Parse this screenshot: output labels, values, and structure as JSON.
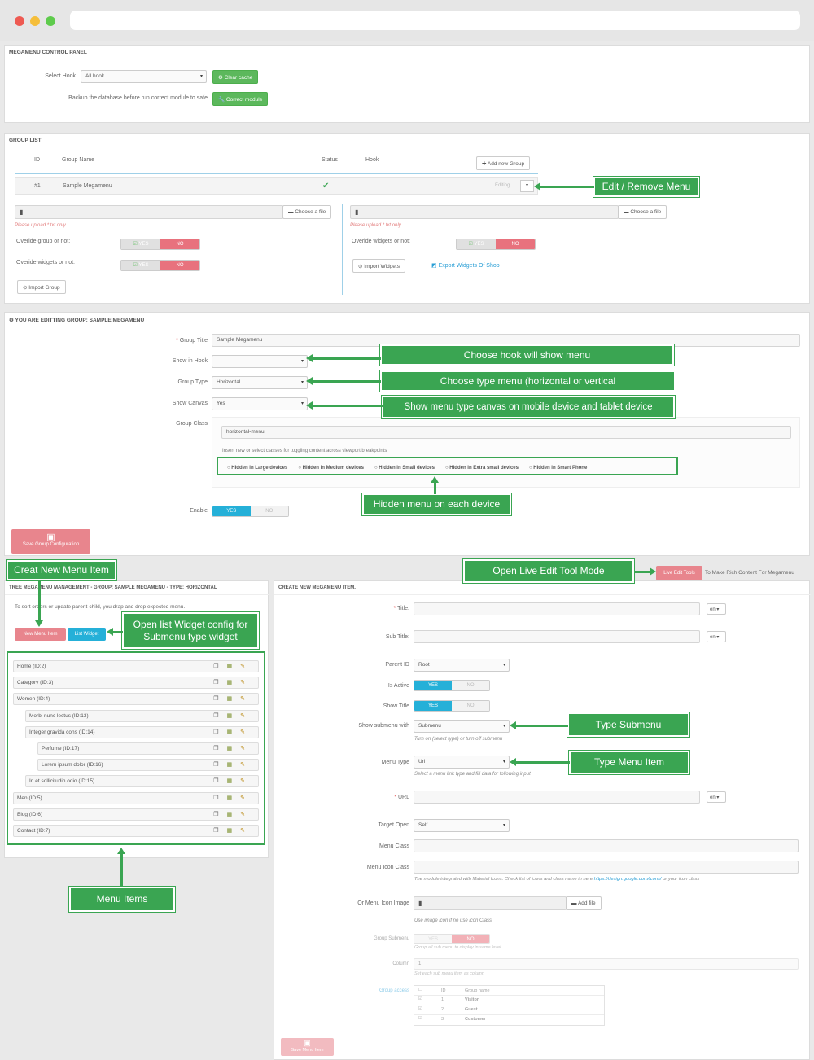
{
  "window": {
    "colors": {
      "close": "#ee5a52",
      "min": "#f5be3a",
      "max": "#5ecb4c"
    }
  },
  "control_panel": {
    "title": "MEGAMENU CONTROL PANEL",
    "select_hook_label": "Select Hook",
    "select_hook_value": "All hook",
    "clear_cache": "Clear cache",
    "backup_label": "Backup the database before run correct module to safe",
    "correct_module": "Correct module"
  },
  "group_list": {
    "title": "GROUP LIST",
    "columns": {
      "id": "ID",
      "name": "Group Name",
      "status": "Status",
      "hook": "Hook"
    },
    "add_new": "Add new Group",
    "row": {
      "id": "#1",
      "name": "Sample Megamenu",
      "status": "✔",
      "action": "Editing"
    },
    "choose_file": "Choose a file",
    "upload_hint": "Please upload *.txt only",
    "override_group": "Overide group or not:",
    "override_widgets": "Overide widgets or not:",
    "yes": "YES",
    "no": "NO",
    "import_group": "Import Group",
    "import_widgets": "Import Widgets",
    "export_widgets": "Export Widgets Of Shop"
  },
  "editing": {
    "title": "YOU ARE EDITTING GROUP: SAMPLE MEGAMENU",
    "group_title_label": "Group Title",
    "group_title_value": "Sample Megamenu",
    "show_in_hook": "Show in Hook",
    "group_type": "Group Type",
    "group_type_value": "Horizontal",
    "show_canvas": "Show Canvas",
    "show_canvas_value": "Yes",
    "group_class": "Group Class",
    "group_class_value": "horizontal-menu",
    "class_hint": "Insert new or select classes for toggling content across viewport breakpoints",
    "hidden": [
      "Hidden in Large devices",
      "Hidden in Medium devices",
      "Hidden in Small devices",
      "Hidden in Extra small devices",
      "Hidden in Smart Phone"
    ],
    "enable": "Enable",
    "yes": "YES",
    "no": "NO",
    "save": "Save Group Configuration"
  },
  "tree": {
    "title": "TREE MEGAMENU MANAGEMENT - GROUP: SAMPLE MEGAMENU - TYPE: HORIZONTAL",
    "hint": "To sort orders or update parent-child, you drap and drop expected menu.",
    "new_item": "New Menu Item",
    "list_widget": "List Widget",
    "items": [
      "Home (ID:2)",
      "Category (ID:3)",
      "Women (ID:4)",
      "Morbi nunc lectus (ID:13)",
      "Integer gravida cons (ID:14)",
      "Perfume (ID:17)",
      "Lorem ipsum dolor (ID:16)",
      "In et sollicitudin odio (ID:15)",
      "Men (ID:5)",
      "Blog (ID:6)",
      "Contact (ID:7)"
    ]
  },
  "create": {
    "title": "CREATE NEW MEGAMENU ITEM.",
    "live_edit": "Live Edit Tools",
    "live_edit_note": "To Make Rich Content For Megamenu",
    "title_label": "Title:",
    "subtitle_label": "Sub Title:",
    "lang": "en",
    "parent_label": "Parent ID",
    "parent_value": "Root",
    "active_label": "Is Active",
    "show_title_label": "Show Title",
    "show_submenu_label": "Show submenu with",
    "show_submenu_value": "Submenu",
    "submenu_hint": "Turn on (select type) or turn off submenu",
    "menu_type_label": "Menu Type",
    "menu_type_value": "Url",
    "menu_type_hint": "Select a menu link type and fill data for following input",
    "url_label": "URL",
    "target_label": "Target Open",
    "target_value": "Self",
    "menu_class_label": "Menu Class",
    "menu_icon_label": "Menu Icon Class",
    "icon_hint": "The module integrated with Material Icons. Check list of icons and class name in here",
    "icon_link": "https://design.google.com/icons/",
    "icon_hint2": "or your icon class",
    "or_image_label": "Or Menu Icon Image",
    "add_file": "Add file",
    "image_hint": "Use image icon if no use icon Class",
    "group_submenu_label": "Group Submenu",
    "group_submenu_hint": "Group all sub menu to display in same level",
    "column_label": "Column",
    "column_value": "1",
    "column_hint": "Set each sub menu item as column",
    "group_access_label": "Group access",
    "access_cols": {
      "id": "ID",
      "name": "Group name"
    },
    "access_rows": [
      {
        "id": "1",
        "name": "Visitor"
      },
      {
        "id": "2",
        "name": "Guest"
      },
      {
        "id": "3",
        "name": "Customer"
      }
    ],
    "save": "Save Menu Item",
    "yes": "YES",
    "no": "NO"
  },
  "callouts": {
    "edit_remove": "Edit / Remove Menu",
    "choose_hook": "Choose hook will show menu",
    "choose_type": "Choose type menu (horizontal or vertical",
    "show_canvas": "Show menu type canvas on mobile device and tablet device",
    "hidden_menu": "Hidden menu on each device",
    "creat_new": "Creat New Menu Item",
    "open_list": "Open list Widget config for Submenu type widget",
    "menu_items": "Menu Items",
    "live_tool": "Open Live Edit Tool Mode",
    "type_submenu": "Type Submenu",
    "type_menu_item": "Type Menu Item"
  }
}
